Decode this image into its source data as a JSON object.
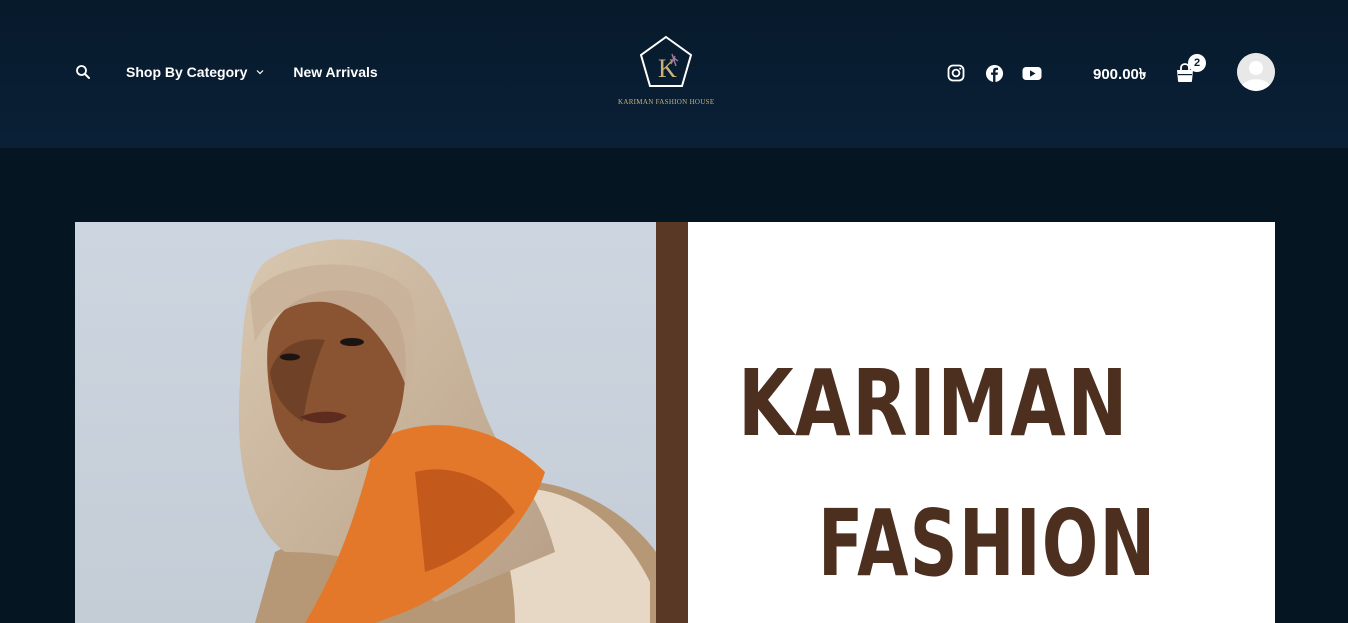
{
  "header": {
    "nav": {
      "shop_by_category": "Shop By Category",
      "new_arrivals": "New Arrivals"
    },
    "logo": {
      "monogram": "K",
      "tagline": "KARIMAN FASHION HOUSE"
    },
    "socials": [
      "instagram-icon",
      "facebook-icon",
      "youtube-icon"
    ],
    "cart": {
      "total": "900.00৳",
      "count": "2"
    }
  },
  "hero": {
    "line1": "KARIMAN",
    "line2": "FASHION"
  },
  "colors": {
    "header_bg": "#0a2036",
    "page_bg": "#061522",
    "brand_brown": "#4d2f20",
    "logo_gold": "#c8b27a"
  }
}
